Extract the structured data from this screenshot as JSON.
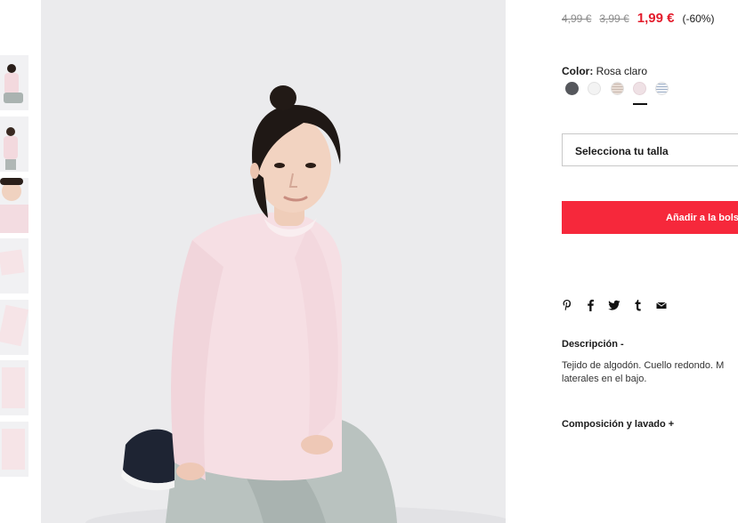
{
  "thumbnails": [
    {
      "alt": "thumb-full"
    },
    {
      "alt": "thumb-back"
    },
    {
      "alt": "thumb-closeup"
    },
    {
      "alt": "thumb-flat-folded"
    },
    {
      "alt": "thumb-flat-detail"
    },
    {
      "alt": "thumb-flat-front"
    },
    {
      "alt": "thumb-flat-back"
    }
  ],
  "price": {
    "original": "4,99 €",
    "previous": "3,99 €",
    "current": "1,99 €",
    "discount": "(-60%)"
  },
  "color": {
    "label": "Color:",
    "selected": "Rosa claro",
    "swatches": [
      {
        "name": "dark-grey",
        "color": "#55575c"
      },
      {
        "name": "white",
        "color": "#f3f3f3"
      },
      {
        "name": "striped-beige",
        "color": "#e8dcd4"
      },
      {
        "name": "light-pink",
        "color": "#efe1e5",
        "selected": true
      },
      {
        "name": "striped-blue",
        "color": "#dfe6ee"
      }
    ]
  },
  "size": {
    "placeholder": "Selecciona tu talla"
  },
  "add_to_bag": {
    "label": "Añadir a la bols"
  },
  "share": {
    "icons": [
      "pinterest-icon",
      "facebook-icon",
      "twitter-icon",
      "tumblr-icon",
      "email-icon"
    ]
  },
  "description": {
    "title": "Descripción  -",
    "text_line1": "Tejido de algodón. Cuello redondo. M",
    "text_line2": "laterales en el bajo."
  },
  "composition": {
    "title": "Composición y lavado  +"
  },
  "colors": {
    "accent": "#f6283b",
    "sale": "#e31c2c"
  }
}
